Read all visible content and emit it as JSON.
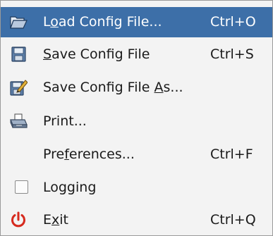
{
  "menu": {
    "items": [
      {
        "pre": "L",
        "mnemonic": "o",
        "post": "ad Config File...",
        "accel": "Ctrl+O",
        "icon": "folder-open-icon",
        "highlighted": true
      },
      {
        "pre": "",
        "mnemonic": "S",
        "post": "ave Config File",
        "accel": "Ctrl+S",
        "icon": "floppy-disk-icon"
      },
      {
        "pre": "Save Config File ",
        "mnemonic": "A",
        "post": "s...",
        "accel": "",
        "icon": "floppy-pen-icon"
      },
      {
        "pre": "Print...",
        "mnemonic": "",
        "post": "",
        "accel": "",
        "icon": "printer-icon"
      },
      {
        "pre": "Pre",
        "mnemonic": "f",
        "post": "erences...",
        "accel": "Ctrl+F",
        "icon": ""
      },
      {
        "pre": "Logging",
        "mnemonic": "",
        "post": "",
        "accel": "",
        "icon": "checkbox-icon",
        "checked": false
      },
      {
        "pre": "E",
        "mnemonic": "x",
        "post": "it",
        "accel": "Ctrl+Q",
        "icon": "power-icon"
      }
    ]
  },
  "colors": {
    "highlight": "#3d6fa8",
    "exit_icon": "#d62a1e"
  }
}
